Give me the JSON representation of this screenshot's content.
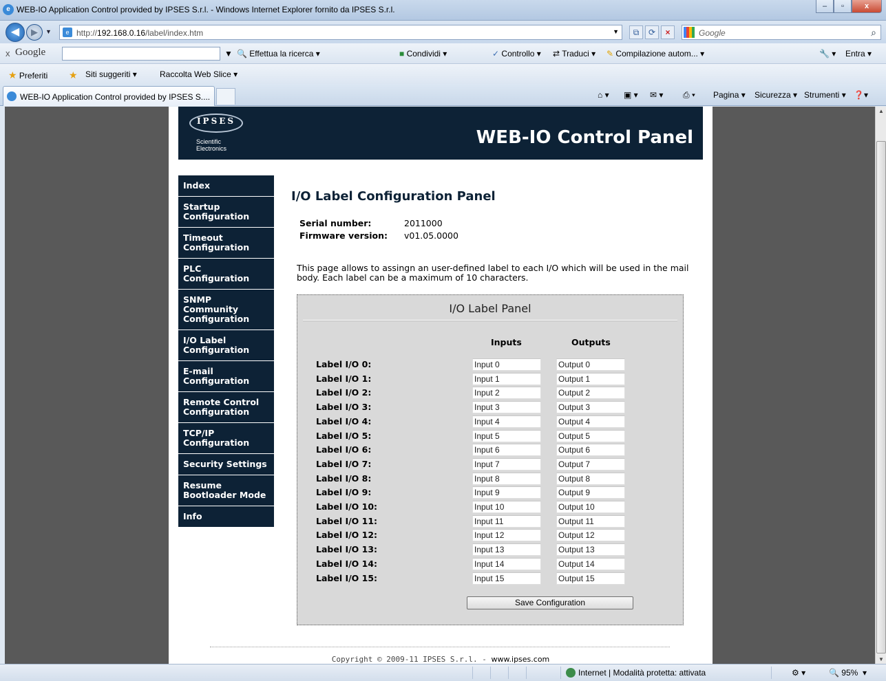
{
  "window": {
    "title": "WEB-IO Application Control provided by IPSES S.r.l. - Windows Internet Explorer fornito da IPSES S.r.l.",
    "min": "–",
    "max": "▫",
    "close": "x"
  },
  "address": {
    "url_prefix": "http://",
    "url_host": "192.168.0.16",
    "url_path": "/label/index.htm",
    "search_placeholder": "Google"
  },
  "google_toolbar": {
    "brand": "Google",
    "search": "Effettua la ricerca",
    "share": "Condividi",
    "check": "Controllo",
    "translate": "Traduci",
    "autofill": "Compilazione autom...",
    "signin": "Entra"
  },
  "favorites": {
    "label": "Preferiti",
    "suggested": "Siti suggeriti",
    "webslice": "Raccolta Web Slice"
  },
  "tab": {
    "label": "WEB-IO Application Control provided by IPSES S....",
    "page": "Pagina",
    "security": "Sicurezza",
    "tools": "Strumenti"
  },
  "header": {
    "logo_text": "IPSES",
    "logo_sub1": "Scientific",
    "logo_sub2": "Electronics",
    "title": "WEB-IO Control Panel"
  },
  "menu": [
    [
      "Index"
    ],
    [
      "Startup",
      "Configuration"
    ],
    [
      "Timeout",
      "Configuration"
    ],
    [
      "PLC Configuration"
    ],
    [
      "SNMP Community",
      "Configuration"
    ],
    [
      "I/O Label",
      "Configuration"
    ],
    [
      "E-mail",
      "Configuration"
    ],
    [
      "Remote Control",
      "Configuration"
    ],
    [
      "TCP/IP",
      "Configuration"
    ],
    [
      "Security Settings"
    ],
    [
      "Resume",
      "Bootloader Mode"
    ],
    [
      "Info"
    ]
  ],
  "content": {
    "heading": "I/O Label Configuration Panel",
    "serial_label": "Serial number:",
    "serial_value": "2011000",
    "firmware_label": "Firmware version:",
    "firmware_value": "v01.05.0000",
    "description": "This page allows to assingn an user-defined label to each I/O which will be used in the mail body. Each label can be a maximum of 10 characters."
  },
  "panel": {
    "title": "I/O Label Panel",
    "inputs_header": "Inputs",
    "outputs_header": "Outputs",
    "rows": [
      {
        "label": "Label I/O 0:",
        "input": "Input 0",
        "output": "Output 0"
      },
      {
        "label": "Label I/O 1:",
        "input": "Input 1",
        "output": "Output 1"
      },
      {
        "label": "Label I/O 2:",
        "input": "Input 2",
        "output": "Output 2"
      },
      {
        "label": "Label I/O 3:",
        "input": "Input 3",
        "output": "Output 3"
      },
      {
        "label": "Label I/O 4:",
        "input": "Input 4",
        "output": "Output 4"
      },
      {
        "label": "Label I/O 5:",
        "input": "Input 5",
        "output": "Output 5"
      },
      {
        "label": "Label I/O 6:",
        "input": "Input 6",
        "output": "Output 6"
      },
      {
        "label": "Label I/O 7:",
        "input": "Input 7",
        "output": "Output 7"
      },
      {
        "label": "Label I/O 8:",
        "input": "Input 8",
        "output": "Output 8"
      },
      {
        "label": "Label I/O 9:",
        "input": "Input 9",
        "output": "Output 9"
      },
      {
        "label": "Label I/O 10:",
        "input": "Input 10",
        "output": "Output 10"
      },
      {
        "label": "Label I/O 11:",
        "input": "Input 11",
        "output": "Output 11"
      },
      {
        "label": "Label I/O 12:",
        "input": "Input 12",
        "output": "Output 12"
      },
      {
        "label": "Label I/O 13:",
        "input": "Input 13",
        "output": "Output 13"
      },
      {
        "label": "Label I/O 14:",
        "input": "Input 14",
        "output": "Output 14"
      },
      {
        "label": "Label I/O 15:",
        "input": "Input 15",
        "output": "Output 15"
      }
    ],
    "save_label": "Save Configuration"
  },
  "footer": {
    "copyright": "Copyright © 2009-11 IPSES S.r.l. - ",
    "link": "www.ipses.com"
  },
  "statusbar": {
    "zone": "Internet | Modalità protetta: attivata",
    "zoom": "95%"
  }
}
